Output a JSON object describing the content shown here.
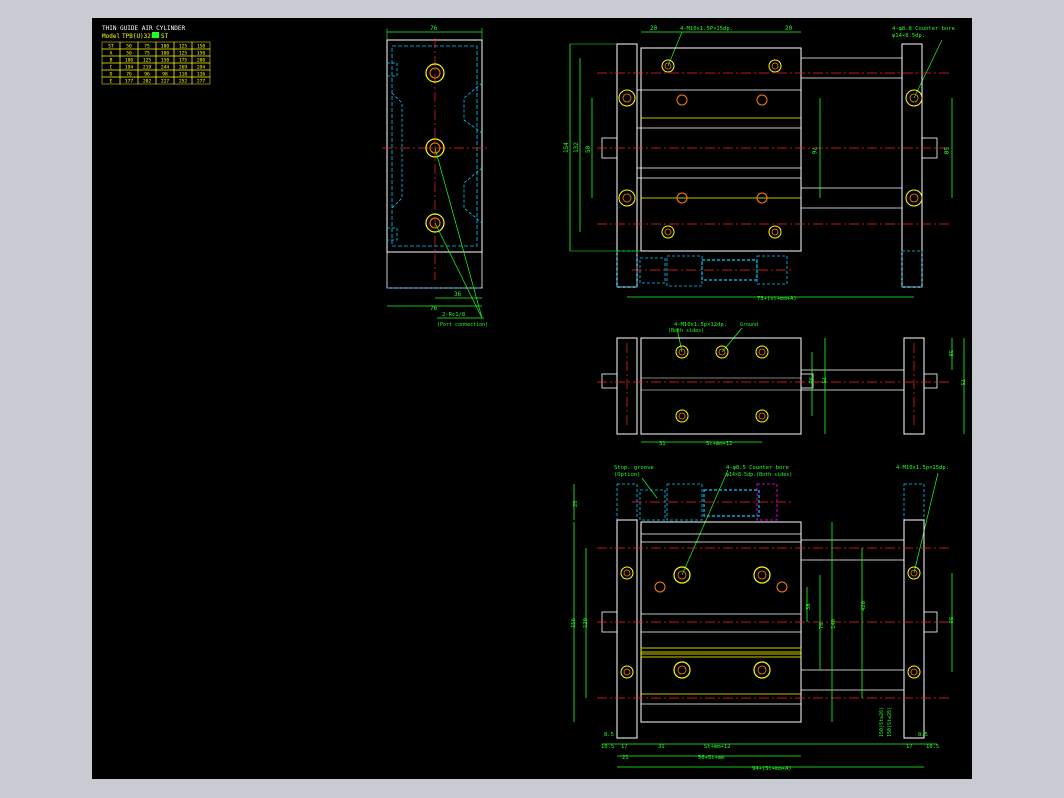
{
  "colors": {
    "background": "#000000",
    "frame": "#c8ccd2",
    "outline": "#ffffff",
    "centerline": "#ff2020",
    "hidden": "#00c8ff",
    "dimension": "#20ff20",
    "hole": "#ffff00",
    "hole_inner": "#ff8000",
    "highlight": "#ff00ff",
    "table": "#ffff00"
  },
  "title_block": {
    "title": "THIN GUIDE AIR CYLINDER",
    "model_label": "Model",
    "model_value": "TPB(U)32×",
    "model_suffix": "ST",
    "header": [
      "ST",
      "50",
      "75",
      "100",
      "125",
      "150"
    ],
    "rows": [
      [
        "A",
        "50",
        "75",
        "100",
        "125",
        "150"
      ],
      [
        "B",
        "100",
        "125",
        "150",
        "175",
        "200"
      ],
      [
        "C",
        "194",
        "219",
        "244",
        "269",
        "294"
      ],
      [
        "D",
        "76",
        "96",
        "98",
        "110",
        "136"
      ],
      [
        "E",
        "177",
        "202",
        "227",
        "252",
        "277"
      ]
    ]
  },
  "side_view": {
    "dim_width_top": "76",
    "dim_width_bottom": "76",
    "dim_offset": "36",
    "port_label": "2-Rc1/8",
    "port_note": "(Port connection)"
  },
  "top_view": {
    "dim_left": "20",
    "dim_right": "20",
    "tap_note": "4-M10x1.5P×15dp.",
    "counter_note_1": "4-φ8.8 Counter bore",
    "counter_note_2": "φ14×8.5dp.",
    "dim_154": "154",
    "dim_132": "132",
    "dim_50": "50",
    "dim_76": "76",
    "dim_50_right": "50",
    "dim_bottom": "73+(st+mm+A)"
  },
  "mid_view": {
    "tap_note": "4-M10x1.5p×12dp.",
    "tap_sub": "(Both sides)",
    "ground_note": "Ground",
    "dim_31": "31",
    "dim_st": "St+mm+12",
    "dim_30": "30",
    "dim_75": "75",
    "dim_38": "38",
    "dim_75_right": "75"
  },
  "front_view": {
    "stop_note_1": "Stop. groove",
    "stop_note_2": "(Option)",
    "cb_note_1": "4-φ8.5 Counter bore",
    "cb_note_2": "φ14×8.5dp.(Both sides)",
    "tap_note": "4-M10x1.5p×15dp.",
    "dim_25": "25",
    "dim_156": "156",
    "dim_120": "120",
    "dim_38": "38",
    "dim_76": "76",
    "dim_140": "140",
    "dim_420": "420",
    "dim_80": "80",
    "dim_8_5_left": "8.5",
    "dim_10_5_left": "10.5",
    "dim_17_left": "17",
    "dim_21": "21",
    "dim_31": "31",
    "dim_st": "St+mm+12",
    "dim_56": "56+St+mm",
    "dim_17_right": "17",
    "dim_10_5_right": "10.5",
    "dim_8_5_right": "8.5",
    "dim_total": "94+(St+mm+A)",
    "vertical_note_1": "150(St≥26)",
    "vertical_note_2": "150(St≤25)"
  }
}
